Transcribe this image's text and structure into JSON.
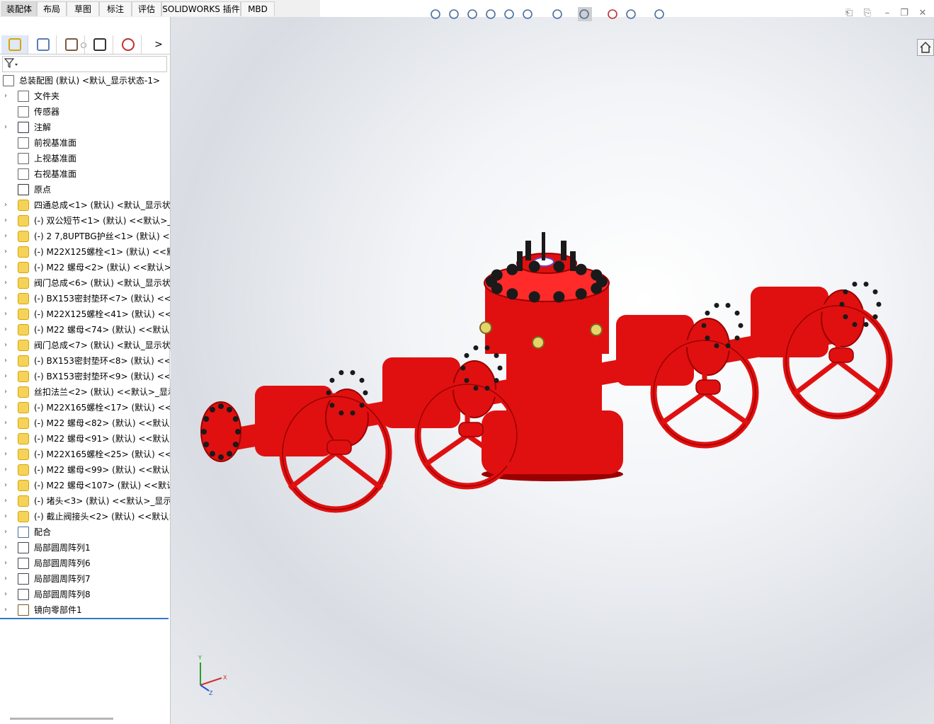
{
  "tabs": [
    {
      "label": "装配体",
      "active": true
    },
    {
      "label": "布局",
      "active": false
    },
    {
      "label": "草图",
      "active": false
    },
    {
      "label": "标注",
      "active": false
    },
    {
      "label": "评估",
      "active": false
    },
    {
      "label": "SOLIDWORKS 插件",
      "active": false
    },
    {
      "label": "MBD",
      "active": false
    }
  ],
  "feature_manager": {
    "tabs": [
      "featuremanager-tree-icon",
      "property-manager-icon",
      "configuration-manager-icon",
      "dimxpert-icon",
      "display-manager-icon"
    ],
    "more_label": ">",
    "filter_icon": "filter-icon",
    "root": "总装配图 (默认) <默认_显示状态-1>",
    "items": [
      {
        "label": "文件夹",
        "icon": "folder-icon",
        "expand": true
      },
      {
        "label": "传感器",
        "icon": "sensor-icon",
        "expand": false
      },
      {
        "label": "注解",
        "icon": "annotation-icon",
        "expand": true
      },
      {
        "label": "前视基准面",
        "icon": "plane-icon",
        "expand": false
      },
      {
        "label": "上视基准面",
        "icon": "plane-icon",
        "expand": false
      },
      {
        "label": "右视基准面",
        "icon": "plane-icon",
        "expand": false
      },
      {
        "label": "原点",
        "icon": "origin-icon",
        "expand": false
      },
      {
        "label": "四通总成<1> (默认) <默认_显示状",
        "icon": "subassembly-icon",
        "expand": true
      },
      {
        "label": "(-) 双公短节<1> (默认) <<默认>_显",
        "icon": "part-icon",
        "expand": true
      },
      {
        "label": "(-) 2 7,8UPTBG护丝<1> (默认) <<",
        "icon": "part-icon",
        "expand": true
      },
      {
        "label": "(-) M22X125螺栓<1> (默认) <<默",
        "icon": "part-icon",
        "expand": true
      },
      {
        "label": "(-) M22 螺母<2> (默认) <<默认>_",
        "icon": "part-icon",
        "expand": true
      },
      {
        "label": "阀门总成<6> (默认) <默认_显示状",
        "icon": "subassembly-icon",
        "expand": true
      },
      {
        "label": "(-) BX153密封垫环<7> (默认) <<默",
        "icon": "part-icon",
        "expand": true
      },
      {
        "label": "(-) M22X125螺栓<41> (默认) <<默",
        "icon": "part-icon",
        "expand": true
      },
      {
        "label": "(-) M22 螺母<74> (默认) <<默认>",
        "icon": "part-icon",
        "expand": true
      },
      {
        "label": "阀门总成<7> (默认) <默认_显示状",
        "icon": "subassembly-icon",
        "expand": true
      },
      {
        "label": "(-) BX153密封垫环<8> (默认) <<默",
        "icon": "part-icon",
        "expand": true
      },
      {
        "label": "(-) BX153密封垫环<9> (默认) <<默",
        "icon": "part-icon",
        "expand": true
      },
      {
        "label": "丝扣法兰<2> (默认) <<默认>_显示",
        "icon": "part-icon",
        "expand": true
      },
      {
        "label": "(-) M22X165螺栓<17> (默认) <<默",
        "icon": "part-icon",
        "expand": true
      },
      {
        "label": "(-) M22 螺母<82> (默认) <<默认>",
        "icon": "part-icon",
        "expand": true
      },
      {
        "label": "(-) M22 螺母<91> (默认) <<默认>",
        "icon": "part-icon",
        "expand": true
      },
      {
        "label": "(-) M22X165螺栓<25> (默认) <<默",
        "icon": "part-icon",
        "expand": true
      },
      {
        "label": "(-) M22 螺母<99> (默认) <<默认>",
        "icon": "part-icon",
        "expand": true
      },
      {
        "label": "(-) M22 螺母<107> (默认) <<默认",
        "icon": "part-icon",
        "expand": true
      },
      {
        "label": "(-) 堵头<3> (默认) <<默认>_显示状",
        "icon": "part-icon",
        "expand": true
      },
      {
        "label": "(-) 截止阀接头<2> (默认) <<默认>",
        "icon": "part-icon",
        "expand": true
      },
      {
        "label": "配合",
        "icon": "mates-icon",
        "expand": true
      },
      {
        "label": "局部圆周阵列1",
        "icon": "circular-pattern-icon",
        "expand": true
      },
      {
        "label": "局部圆周阵列6",
        "icon": "circular-pattern-icon",
        "expand": true
      },
      {
        "label": "局部圆周阵列7",
        "icon": "circular-pattern-icon",
        "expand": true
      },
      {
        "label": "局部圆周阵列8",
        "icon": "circular-pattern-icon",
        "expand": true
      },
      {
        "label": "镜向零部件1",
        "icon": "mirror-components-icon",
        "expand": true
      }
    ]
  },
  "heads_up_toolbar": [
    "zoom-to-fit-icon",
    "zoom-to-area-icon",
    "previous-view-icon",
    "section-view-icon",
    "dynamic-annotation-icon",
    "view-orientation-icon",
    "display-style-icon",
    "hide-show-items-icon",
    "edit-appearance-icon",
    "apply-scene-icon",
    "view-settings-icon"
  ],
  "window_controls": [
    "tile-left-icon",
    "tile-right-icon",
    "minimize-icon",
    "restore-icon",
    "close-icon"
  ],
  "triad": {
    "x": "X",
    "y": "Y",
    "z": "Z"
  },
  "colors": {
    "model_red": "#e01010",
    "accent_blue": "#2f7bd0"
  }
}
